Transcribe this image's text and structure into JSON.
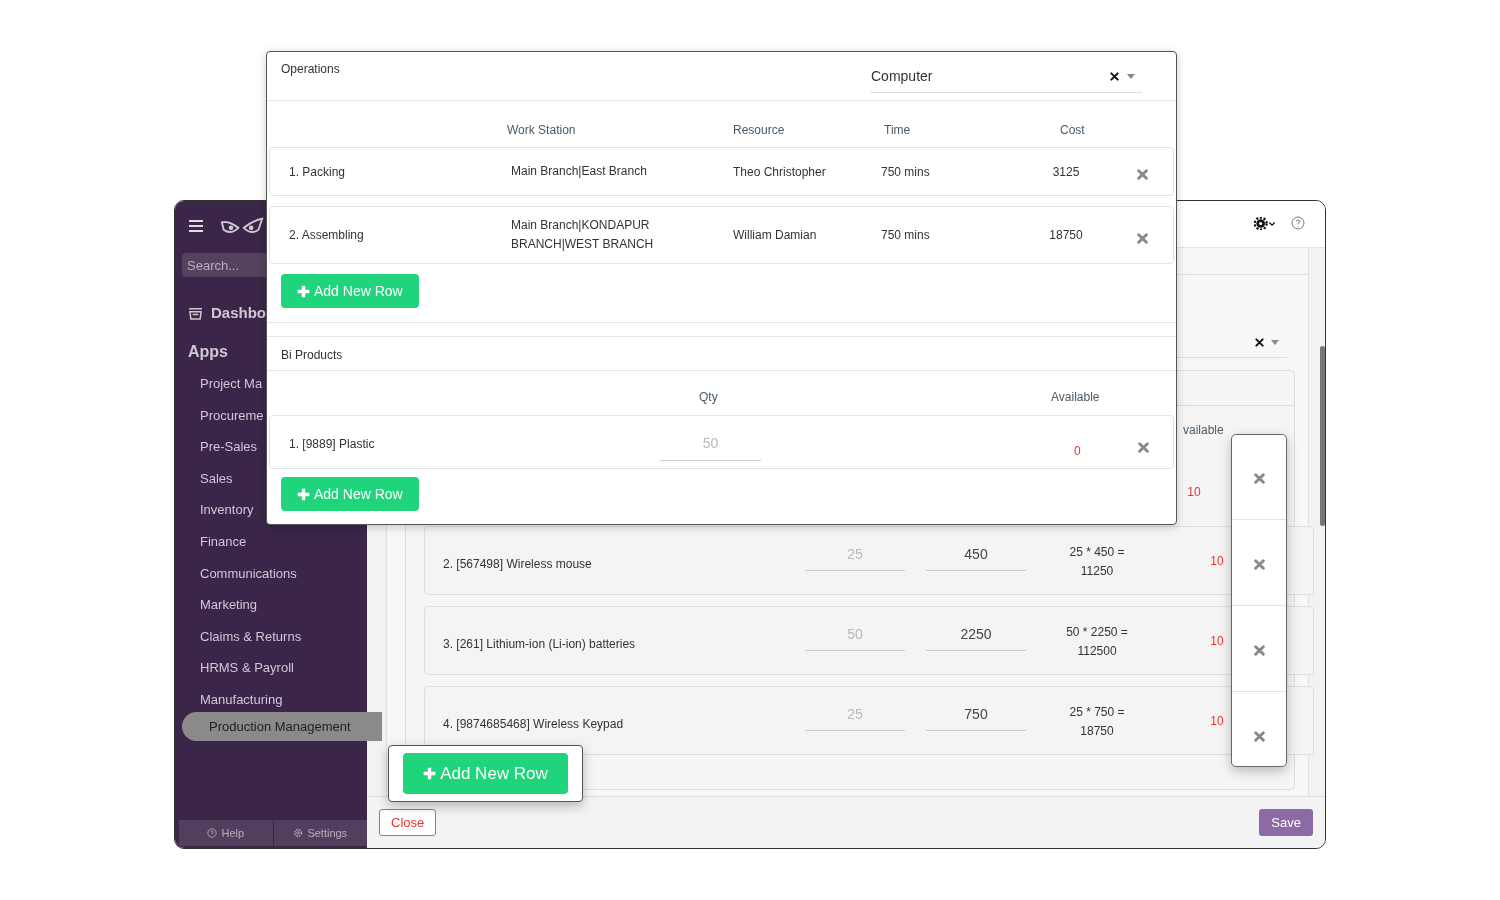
{
  "sidebar": {
    "search_placeholder": "Search...",
    "dashboard": "Dashbo",
    "apps_heading": "Apps",
    "items": [
      {
        "label": "Project Ma",
        "selected": false
      },
      {
        "label": "Procureme",
        "selected": false
      },
      {
        "label": "Pre-Sales",
        "selected": false
      },
      {
        "label": "Sales",
        "selected": false
      },
      {
        "label": "Inventory",
        "selected": false
      },
      {
        "label": "Finance",
        "selected": false
      },
      {
        "label": "Communications",
        "selected": false
      },
      {
        "label": "Marketing",
        "selected": false
      },
      {
        "label": "Claims & Returns",
        "selected": false
      },
      {
        "label": "HRMS & Payroll",
        "selected": false
      },
      {
        "label": "Manufacturing",
        "selected": false
      },
      {
        "label": "Production Management",
        "selected": true
      }
    ],
    "footer": [
      "Help",
      "Settings"
    ]
  },
  "back_form": {
    "column_partial": "vailable",
    "rows": [
      {
        "available": "10"
      },
      {
        "name": "2. [567498] Wireless mouse",
        "qty": "25",
        "price": "450",
        "total": "25 * 450 = 11250",
        "available": "10"
      },
      {
        "name": "3. [261] Lithium-ion (Li-ion) batteries",
        "qty": "50",
        "price": "2250",
        "total": "50 * 2250 = 112500",
        "available": "10"
      },
      {
        "name": "4. [9874685468] Wireless Keypad",
        "qty": "25",
        "price": "750",
        "total": "25 * 750 = 18750",
        "available": "10"
      }
    ],
    "add_button": "Add New Row",
    "close_button": "Close",
    "save_button": "Save"
  },
  "dialog": {
    "operations": {
      "title": "Operations",
      "select_value": "Computer",
      "columns": [
        "Work Station",
        "Resource",
        "Time",
        "Cost"
      ],
      "rows": [
        {
          "name": "1. Packing",
          "work_station": "Main Branch|East Branch",
          "resource": "Theo Christopher",
          "time": "750 mins",
          "cost": "3125"
        },
        {
          "name": "2. Assembling",
          "work_station": "Main Branch|KONDAPUR BRANCH|WEST BRANCH",
          "resource": "William Damian",
          "time": "750 mins",
          "cost": "18750"
        }
      ],
      "add_button": "Add New Row"
    },
    "bi_products": {
      "title": "Bi Products",
      "columns": [
        "Qty",
        "Available"
      ],
      "rows": [
        {
          "name": "1. [9889] Plastic",
          "qty": "50",
          "available": "0"
        }
      ],
      "add_button": "Add New Row"
    }
  }
}
